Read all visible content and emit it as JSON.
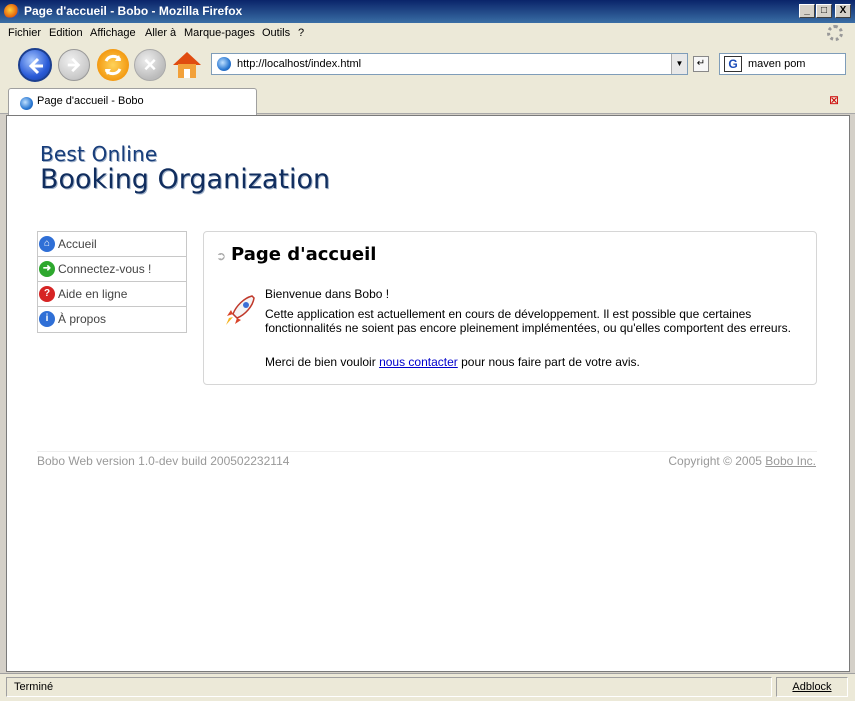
{
  "window": {
    "title": "Page d'accueil - Bobo - Mozilla Firefox",
    "buttons": {
      "minimize": "_",
      "maximize": "□",
      "close": "X"
    }
  },
  "menu": [
    "Fichier",
    "Edition",
    "Affichage",
    "Aller à",
    "Marque-pages",
    "Outils",
    "?"
  ],
  "navigation": {
    "url": "http://localhost/index.html",
    "search_query": "maven pom",
    "search_engine_glyph": "G"
  },
  "tab": {
    "label": "Page d'accueil - Bobo"
  },
  "page": {
    "logo_line1": "Best Online",
    "logo_line2": "Booking Organization",
    "sidebar": [
      {
        "label": "Accueil",
        "icon": "home-icon",
        "color": "#2f6fd6",
        "glyph": "⌂"
      },
      {
        "label": "Connectez-vous !",
        "icon": "login-arrow-icon",
        "color": "#2ea82e",
        "glyph": "➜"
      },
      {
        "label": "Aide en ligne",
        "icon": "help-icon",
        "color": "#d62424",
        "glyph": "?"
      },
      {
        "label": "À propos",
        "icon": "info-icon",
        "color": "#2f6fd6",
        "glyph": "i"
      }
    ],
    "heading": "Page d'accueil",
    "welcome": "Bienvenue dans Bobo !",
    "paragraph": "Cette application est actuellement en cours de développement. Il est possible que certaines fonctionnalités ne soient pas encore pleinement implémentées, ou qu'elles comportent des erreurs.",
    "contact_prefix": "Merci de bien vouloir",
    "contact_link": "nous contacter",
    "contact_suffix": "pour nous faire part de votre avis.",
    "footer_version": "Bobo Web version 1.0-dev build 200502232114",
    "footer_copyright": "Copyright © 2005",
    "footer_company": "Bobo Inc."
  },
  "status": {
    "message": "Terminé",
    "adblock": "Adblock"
  }
}
